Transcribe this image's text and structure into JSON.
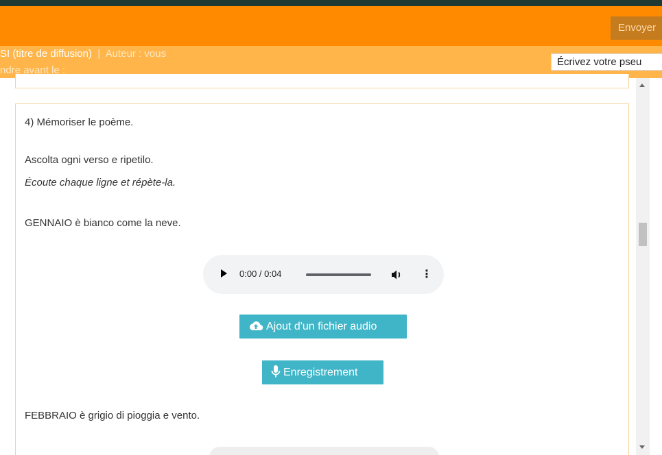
{
  "header": {
    "send_button": "Envoyer",
    "title_main": "SI (titre de diffusion)",
    "title_separator": "|",
    "title_author": "Auteur : vous",
    "deadline": "ndre avant le :",
    "pseudo_placeholder": "Écrivez votre pseudo",
    "pseudo_visible": "Écrivez votre pseu"
  },
  "content": {
    "heading": "4) Mémoriser le poème.",
    "instruction_it": "Ascolta ogni verso e ripetilo.",
    "instruction_fr": "Écoute chaque ligne et répète-la.",
    "verse_1": "GENNAIO è bianco come la neve.",
    "audio_time": "0:00 / 0:04",
    "upload_button": "Ajout d'un fichier audio",
    "record_button": "Enregistrement",
    "verse_2": "FEBBRAIO è grigio di pioggia e vento."
  },
  "icons": {
    "play": "play-icon",
    "volume": "volume-icon",
    "more": "more-vertical-icon",
    "upload": "cloud-upload-icon",
    "mic": "microphone-icon"
  },
  "colors": {
    "orange": "#ff8a00",
    "light_orange": "#ffb54a",
    "button_blue": "#3fb5c7"
  }
}
